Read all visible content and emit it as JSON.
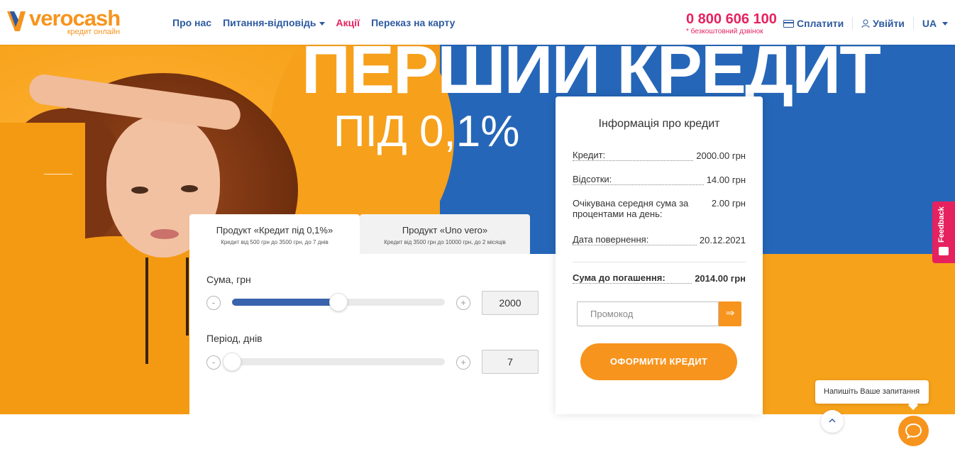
{
  "header": {
    "logo": {
      "name": "verocash",
      "tagline": "кредит онлайн"
    },
    "nav": [
      {
        "label": "Про нас"
      },
      {
        "label": "Питання-відповідь"
      },
      {
        "label": "Акції"
      },
      {
        "label": "Переказ на карту"
      }
    ],
    "phone": {
      "number": "0 800 606 100",
      "note": "* безкоштовний дзвінок"
    },
    "pay_label": "Сплатити",
    "login_label": "Увійти",
    "lang_label": "UA"
  },
  "hero": {
    "title": "ПЕРШИЙ КРЕДИТ",
    "subtitle": "ПІД 0,1%"
  },
  "calculator": {
    "tabs": [
      {
        "title": "Продукт «Кредит під 0,1%»",
        "desc": "Кредит від 500 грн до 3500 грн, до 7 днів"
      },
      {
        "title": "Продукт «Uno vero»",
        "desc": "Кредит від 3500 грн до 10000 грн, до 2 місяців"
      }
    ],
    "amount": {
      "label": "Сума, грн",
      "value": "2000",
      "minus": "-",
      "plus": "+",
      "level": 0.5
    },
    "period": {
      "label": "Період, днів",
      "value": "7",
      "minus": "-",
      "plus": "+",
      "level": 0.0
    }
  },
  "info": {
    "title": "Інформація про кредит",
    "rows": [
      {
        "key": "Кредит:",
        "value": "2000.00 грн"
      },
      {
        "key": "Відсотки:",
        "value": "14.00 грн"
      },
      {
        "key": "Очікувана середня сума за процентами на день:",
        "value": "2.00 грн"
      },
      {
        "key": "Дата повернення:",
        "value": "20.12.2021"
      }
    ],
    "total": {
      "key": "Сума до погашення:",
      "value": "2014.00 грн"
    },
    "promo_placeholder": "Промокод",
    "promo_button": "⇒",
    "cta": "ОФОРМИТИ КРЕДИТ"
  },
  "widgets": {
    "feedback": "Feedback",
    "chat_prompt": "Напишіть Ваше запитання"
  }
}
